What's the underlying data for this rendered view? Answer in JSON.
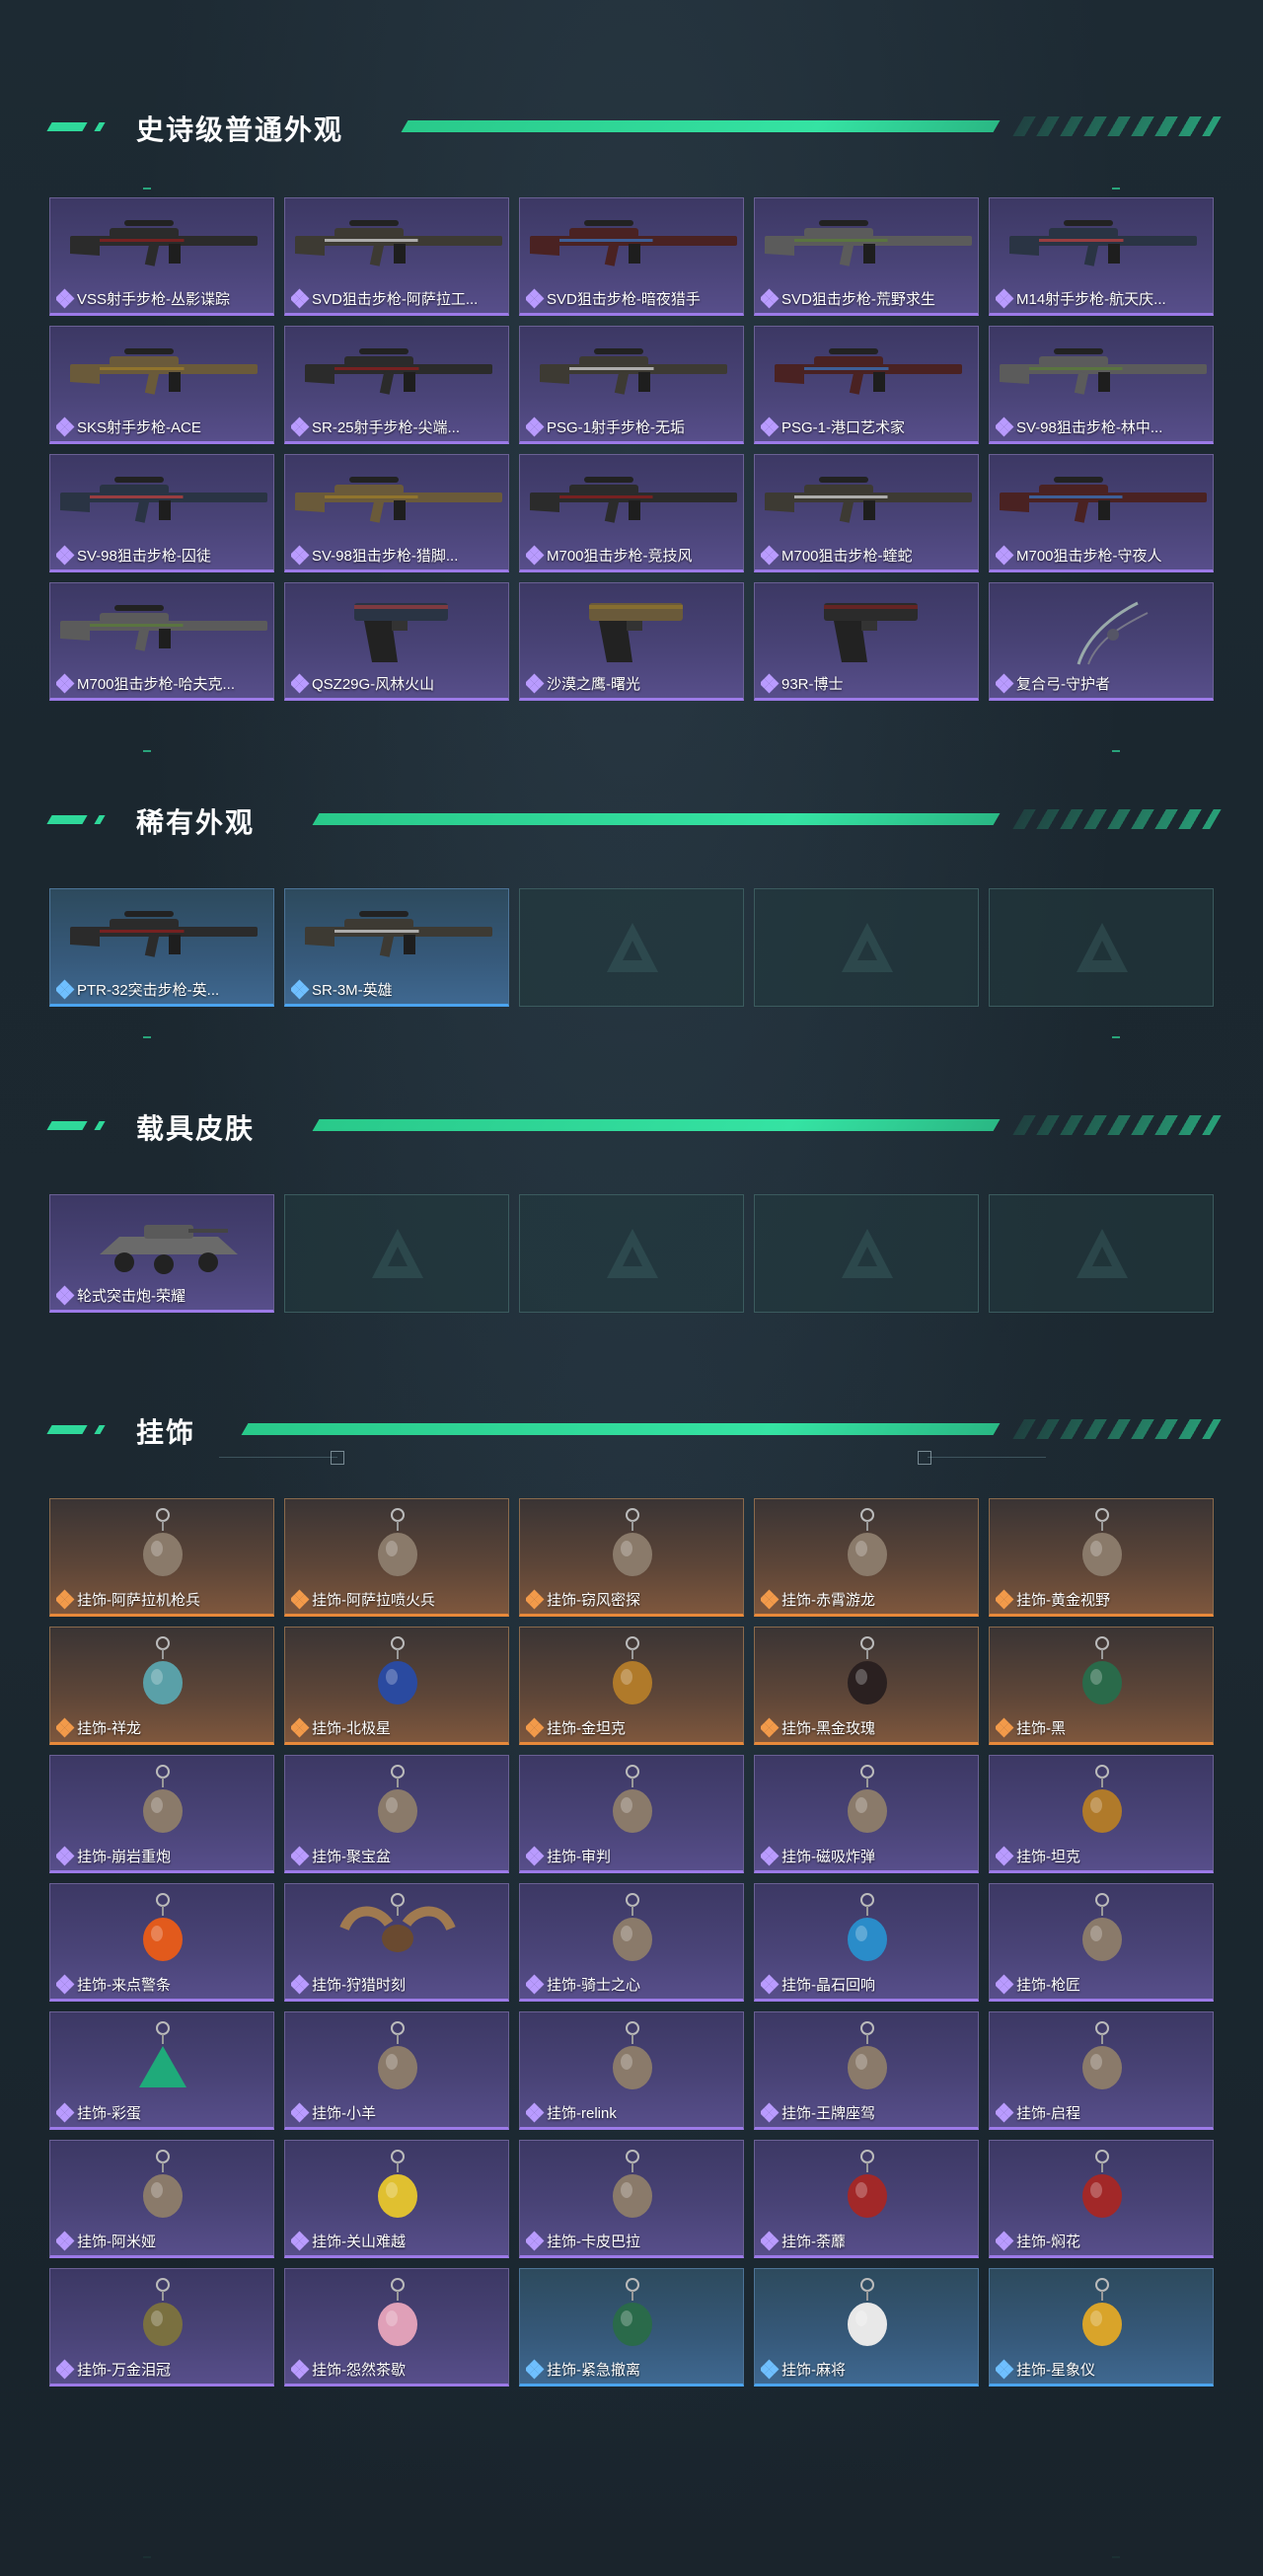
{
  "sections": {
    "epic": {
      "title": "史诗级普通外观",
      "items": [
        {
          "label": "VSS射手步枪-丛影谍踪",
          "rarity": "epic",
          "icon": "rifle-icon"
        },
        {
          "label": "SVD狙击步枪-阿萨拉工...",
          "rarity": "epic",
          "icon": "sniper-rifle-icon"
        },
        {
          "label": "SVD狙击步枪-暗夜猎手",
          "rarity": "epic",
          "icon": "sniper-rifle-icon"
        },
        {
          "label": "SVD狙击步枪-荒野求生",
          "rarity": "epic",
          "icon": "sniper-rifle-icon"
        },
        {
          "label": "M14射手步枪-航天庆...",
          "rarity": "epic",
          "icon": "rifle-icon"
        },
        {
          "label": "SKS射手步枪-ACE",
          "rarity": "epic",
          "icon": "rifle-icon"
        },
        {
          "label": "SR-25射手步枪-尖端...",
          "rarity": "epic",
          "icon": "rifle-icon"
        },
        {
          "label": "PSG-1射手步枪-无垢",
          "rarity": "epic",
          "icon": "rifle-icon"
        },
        {
          "label": "PSG-1-港口艺术家",
          "rarity": "epic",
          "icon": "rifle-icon"
        },
        {
          "label": "SV-98狙击步枪-林中...",
          "rarity": "epic",
          "icon": "sniper-rifle-icon"
        },
        {
          "label": "SV-98狙击步枪-囚徒",
          "rarity": "epic",
          "icon": "sniper-rifle-icon"
        },
        {
          "label": "SV-98狙击步枪-猎脚...",
          "rarity": "epic",
          "icon": "sniper-rifle-icon"
        },
        {
          "label": "M700狙击步枪-竞技风",
          "rarity": "epic",
          "icon": "sniper-rifle-icon"
        },
        {
          "label": "M700狙击步枪-蝰蛇",
          "rarity": "epic",
          "icon": "sniper-rifle-icon"
        },
        {
          "label": "M700狙击步枪-守夜人",
          "rarity": "epic",
          "icon": "sniper-rifle-icon"
        },
        {
          "label": "M700狙击步枪-哈夫克...",
          "rarity": "epic",
          "icon": "sniper-rifle-icon"
        },
        {
          "label": "QSZ29G-风林火山",
          "rarity": "epic",
          "icon": "pistol-icon"
        },
        {
          "label": "沙漠之鹰-曙光",
          "rarity": "epic",
          "icon": "pistol-icon"
        },
        {
          "label": "93R-博士",
          "rarity": "epic",
          "icon": "pistol-icon"
        },
        {
          "label": "复合弓-守护者",
          "rarity": "epic",
          "icon": "bow-icon"
        }
      ]
    },
    "rare": {
      "title": "稀有外观",
      "items": [
        {
          "label": "PTR-32突击步枪-英...",
          "rarity": "rare",
          "icon": "rifle-icon"
        },
        {
          "label": "SR-3M-英雄",
          "rarity": "rare",
          "icon": "smg-icon"
        }
      ],
      "empty_slots": 3
    },
    "vehicle": {
      "title": "载具皮肤",
      "items": [
        {
          "label": "轮式突击炮-荣耀",
          "rarity": "epic",
          "icon": "vehicle-icon"
        }
      ],
      "empty_slots": 4
    },
    "charms": {
      "title": "挂饰",
      "items": [
        {
          "label": "挂饰-阿萨拉机枪兵",
          "rarity": "legend",
          "icon": "charm-figure-icon"
        },
        {
          "label": "挂饰-阿萨拉喷火兵",
          "rarity": "legend",
          "icon": "charm-figure-icon"
        },
        {
          "label": "挂饰-窃风密探",
          "rarity": "legend",
          "icon": "charm-figure-icon"
        },
        {
          "label": "挂饰-赤霄游龙",
          "rarity": "legend",
          "icon": "charm-figure-icon"
        },
        {
          "label": "挂饰-黄金视野",
          "rarity": "legend",
          "icon": "charm-figure-icon"
        },
        {
          "label": "挂饰-祥龙",
          "rarity": "legend",
          "icon": "charm-dragon-icon"
        },
        {
          "label": "挂饰-北极星",
          "rarity": "legend",
          "icon": "charm-star-icon"
        },
        {
          "label": "挂饰-金坦克",
          "rarity": "legend",
          "icon": "charm-tank-icon"
        },
        {
          "label": "挂饰-黑金玫瑰",
          "rarity": "legend",
          "icon": "charm-rose-icon"
        },
        {
          "label": "挂饰-黑",
          "rarity": "legend",
          "icon": "charm-tag-icon"
        },
        {
          "label": "挂饰-崩岩重炮",
          "rarity": "epic",
          "icon": "charm-figure-icon"
        },
        {
          "label": "挂饰-聚宝盆",
          "rarity": "epic",
          "icon": "charm-bowl-icon"
        },
        {
          "label": "挂饰-审判",
          "rarity": "epic",
          "icon": "charm-card-icon"
        },
        {
          "label": "挂饰-磁吸炸弹",
          "rarity": "epic",
          "icon": "charm-bomb-icon"
        },
        {
          "label": "挂饰-坦克",
          "rarity": "epic",
          "icon": "charm-tank-icon"
        },
        {
          "label": "挂饰-来点警条",
          "rarity": "epic",
          "icon": "charm-fire-icon"
        },
        {
          "label": "挂饰-狩猎时刻",
          "rarity": "epic",
          "icon": "charm-antler-icon"
        },
        {
          "label": "挂饰-骑士之心",
          "rarity": "epic",
          "icon": "charm-heart-icon"
        },
        {
          "label": "挂饰-晶石回响",
          "rarity": "epic",
          "icon": "charm-crystal-icon"
        },
        {
          "label": "挂饰-枪匠",
          "rarity": "epic",
          "icon": "charm-box-icon"
        },
        {
          "label": "挂饰-彩蛋",
          "rarity": "epic",
          "icon": "charm-egg-icon"
        },
        {
          "label": "挂饰-小羊",
          "rarity": "epic",
          "icon": "charm-sheep-icon"
        },
        {
          "label": "挂饰-relink",
          "rarity": "epic",
          "icon": "charm-helmet-icon"
        },
        {
          "label": "挂饰-王牌座驾",
          "rarity": "epic",
          "icon": "charm-plane-icon"
        },
        {
          "label": "挂饰-启程",
          "rarity": "epic",
          "icon": "charm-ring-icon"
        },
        {
          "label": "挂饰-阿米娅",
          "rarity": "epic",
          "icon": "charm-figure-icon"
        },
        {
          "label": "挂饰-关山难越",
          "rarity": "epic",
          "icon": "charm-can-icon"
        },
        {
          "label": "挂饰-卡皮巴拉",
          "rarity": "epic",
          "icon": "charm-capybara-icon"
        },
        {
          "label": "挂饰-荼蘼",
          "rarity": "epic",
          "icon": "charm-flower-icon"
        },
        {
          "label": "挂饰-焖花",
          "rarity": "epic",
          "icon": "charm-flower-icon"
        },
        {
          "label": "挂饰-万金泪冠",
          "rarity": "epic",
          "icon": "charm-crown-icon"
        },
        {
          "label": "挂饰-怨然茶歇",
          "rarity": "epic",
          "icon": "charm-cake-icon"
        },
        {
          "label": "挂饰-紧急撤离",
          "rarity": "rare",
          "icon": "charm-tag-icon"
        },
        {
          "label": "挂饰-麻将",
          "rarity": "rare",
          "icon": "charm-mahjong-icon"
        },
        {
          "label": "挂饰-星象仪",
          "rarity": "rare",
          "icon": "charm-orb-icon"
        }
      ]
    }
  },
  "colors": {
    "accent_green": "#2fd89a",
    "epic_purple": "#9c7ae8",
    "rare_blue": "#4ba4ef",
    "legend_orange": "#e8893a"
  }
}
